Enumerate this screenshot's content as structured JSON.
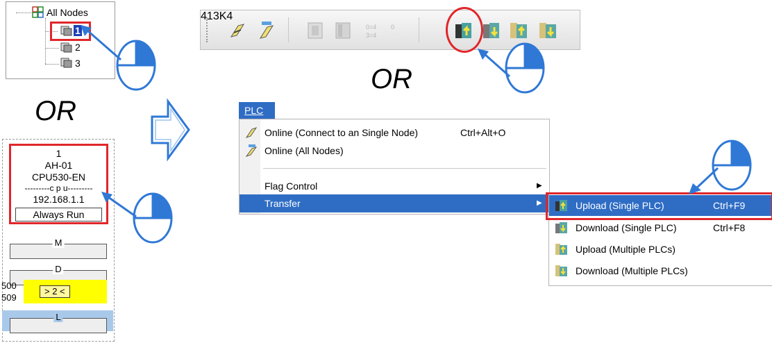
{
  "tree": {
    "root_label": "All Nodes",
    "nodes": [
      "1",
      "2",
      "3"
    ]
  },
  "or_text": "OR",
  "station": {
    "number": "1",
    "model": "AH-01",
    "cpu": "CPU530-EN",
    "cpu_divider": "---------c p u---------",
    "ip": "192.168.1.1",
    "mode": "Always Run",
    "slots": [
      {
        "label": "M"
      },
      {
        "label": "D"
      },
      {
        "label": "L"
      }
    ],
    "range_start": "500",
    "range_end": "509",
    "highlight_text": "> 2 <"
  },
  "menu": {
    "title": "PLC",
    "items": [
      {
        "label": "Online (Connect to an Single Node)",
        "shortcut": "Ctrl+Alt+O"
      },
      {
        "label": "Online (All Nodes)",
        "shortcut": ""
      },
      {
        "label": "Flag Control",
        "shortcut": ""
      },
      {
        "label": "Transfer",
        "shortcut": ""
      }
    ],
    "submenu": [
      {
        "label": "Upload (Single PLC)",
        "shortcut": "Ctrl+F9"
      },
      {
        "label": "Download (Single PLC)",
        "shortcut": "Ctrl+F8"
      },
      {
        "label": "Upload (Multiple PLCs)",
        "shortcut": ""
      },
      {
        "label": "Download (Multiple PLCs)",
        "shortcut": ""
      }
    ]
  },
  "colors": {
    "highlight_red": "#e0262a",
    "menu_blue": "#2f6dc5",
    "arrow_blue": "#2f78d6",
    "yellow": "#ffff00",
    "light_blue_band": "#a9c9ea"
  },
  "icons": {
    "toolbar": [
      "online-single-icon",
      "online-all-icon",
      "disabled-icon-1",
      "disabled-icon-2",
      "disabled-icon-3",
      "disabled-icon-4",
      "upload-single-icon",
      "download-single-icon",
      "upload-multiple-icon",
      "download-multiple-icon"
    ],
    "callout": "mouse-click-icon"
  }
}
